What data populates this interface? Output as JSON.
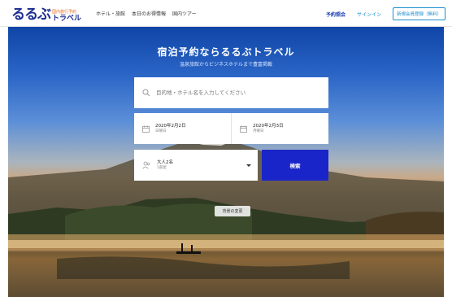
{
  "header": {
    "logo_mark": "るるぶ",
    "logo_tagline": "国内旅行予約",
    "logo_word": "トラベル",
    "nav": [
      "ホテル・旅館",
      "本日のお得情報",
      "国内ツアー"
    ],
    "reservation_check": "予約照会",
    "signin": "サインイン",
    "register": "新規会員登録（無料）"
  },
  "hero": {
    "title": "宿泊予約ならるるぶトラベル",
    "subtitle": "温泉旅館からビジネスホテルまで豊富掲載",
    "search_placeholder": "目的地・ホテル名を入力してください",
    "checkin_date": "2020年2月2日",
    "checkin_day": "日曜日",
    "checkout_date": "2020年2月3日",
    "checkout_day": "月曜日",
    "guests": "大人2名",
    "rooms": "1部屋",
    "search_button": "検索",
    "background_change": "背景の変更"
  },
  "colors": {
    "brand_blue": "#1c2f8f",
    "search_button": "#1a25c9",
    "link_blue": "#1c8ecf"
  }
}
